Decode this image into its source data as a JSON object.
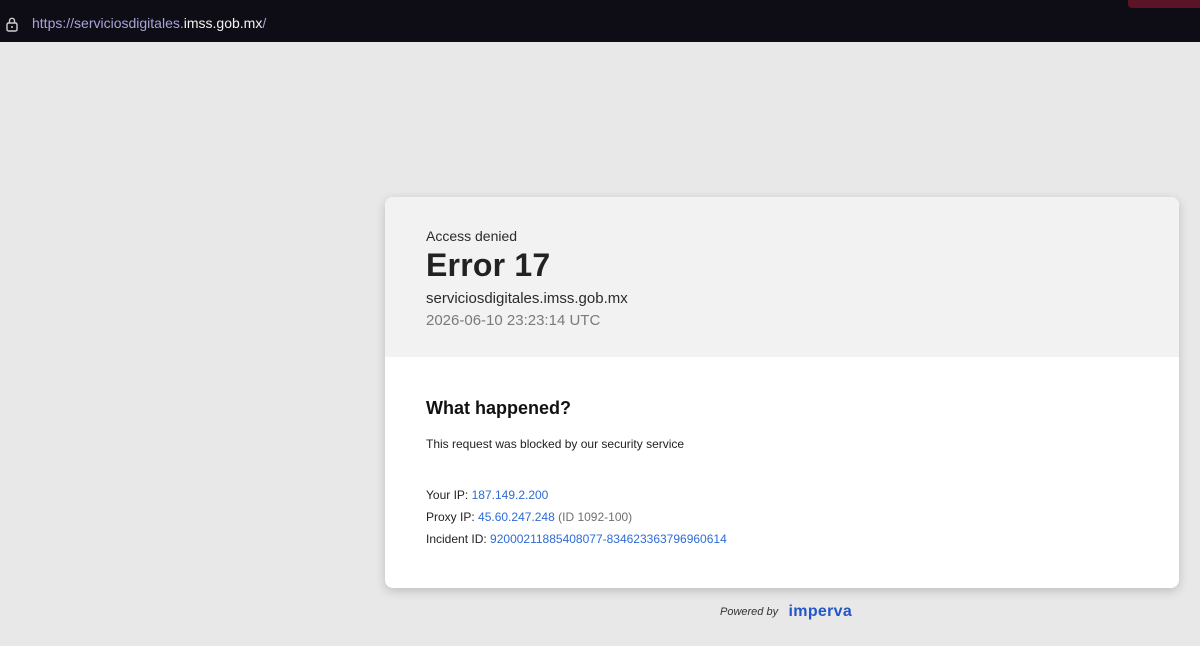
{
  "browser": {
    "url_scheme": "https://",
    "url_subdomain": "serviciosdigitales.",
    "url_host": "imss.gob.mx",
    "url_path": "/",
    "lock_icon": "lock-icon"
  },
  "header": {
    "access_denied": "Access denied",
    "error_title": "Error 17",
    "host": "serviciosdigitales.imss.gob.mx",
    "timestamp": "2026-06-10 23:23:14 UTC"
  },
  "body": {
    "heading": "What happened?",
    "message": "This request was blocked by our security service",
    "your_ip_label": "Your IP:",
    "your_ip_value": "187.149.2.200",
    "proxy_ip_label": "Proxy IP:",
    "proxy_ip_value": "45.60.247.248",
    "proxy_ip_id": "(ID 1092-100)",
    "incident_label": "Incident ID:",
    "incident_value": "920002118854080​77-834623363796960614"
  },
  "footer": {
    "powered_by": "Powered by",
    "brand": "imperva"
  },
  "colors": {
    "link": "#2e6bd6",
    "brand": "#2357c9",
    "page_bg": "#e8e8e8",
    "bar_bg": "#0e0d16"
  }
}
